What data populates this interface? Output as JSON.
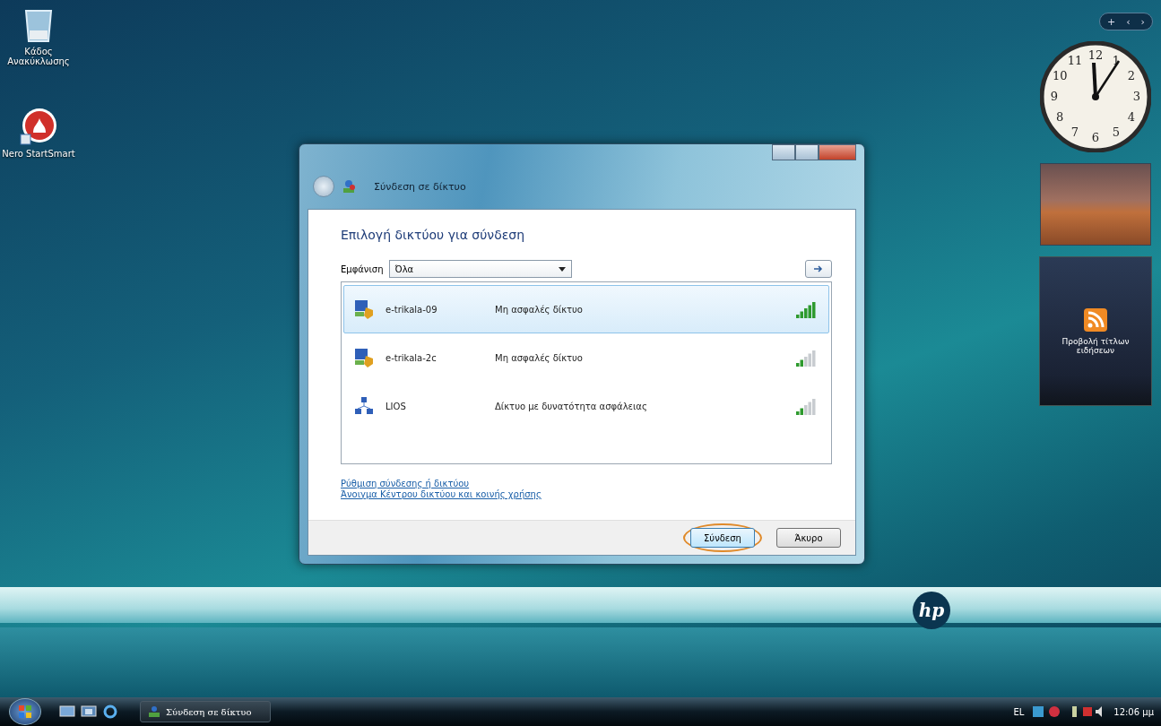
{
  "desktop_icons": [
    {
      "label": "Κάδος Ανακύκλωσης",
      "kind": "recycle"
    },
    {
      "label": "Nero StartSmart",
      "kind": "nero"
    }
  ],
  "window": {
    "title": "Σύνδεση σε δίκτυο",
    "heading": "Επιλογή δικτύου για σύνδεση",
    "filter": {
      "label": "Εμφάνιση",
      "value": "Όλα"
    },
    "networks": [
      {
        "name": "e-trikala-09",
        "security": "Μη ασφαλές δίκτυο",
        "kind": "unsecured",
        "strong_signal": true,
        "selected": true
      },
      {
        "name": "e-trikala-2c",
        "security": "Μη ασφαλές δίκτυο",
        "kind": "unsecured",
        "strong_signal": false,
        "selected": false
      },
      {
        "name": "LIOS",
        "security": "Δίκτυο με δυνατότητα ασφάλειας",
        "kind": "secured",
        "strong_signal": false,
        "selected": false
      }
    ],
    "links": [
      "Ρύθμιση σύνδεσης ή δικτύου",
      "Άνοιγμα Κέντρου δικτύου και κοινής χρήσης"
    ],
    "buttons": [
      {
        "label": "Σύνδεση",
        "highlighted": true
      },
      {
        "label": "Άκυρο",
        "highlighted": false
      }
    ]
  },
  "sidebar": {
    "controls": [
      "+",
      "‹",
      "›"
    ],
    "clock_numbers": [
      "12",
      "1",
      "2",
      "3",
      "4",
      "5",
      "6",
      "7",
      "8",
      "9",
      "10",
      "11"
    ],
    "feed_text": "Προβολή τίτλων ειδήσεων"
  },
  "logo": "hp",
  "taskbar": {
    "task": "Σύνδεση σε δίκτυο",
    "language": "EL",
    "time": "12:06 μμ"
  }
}
